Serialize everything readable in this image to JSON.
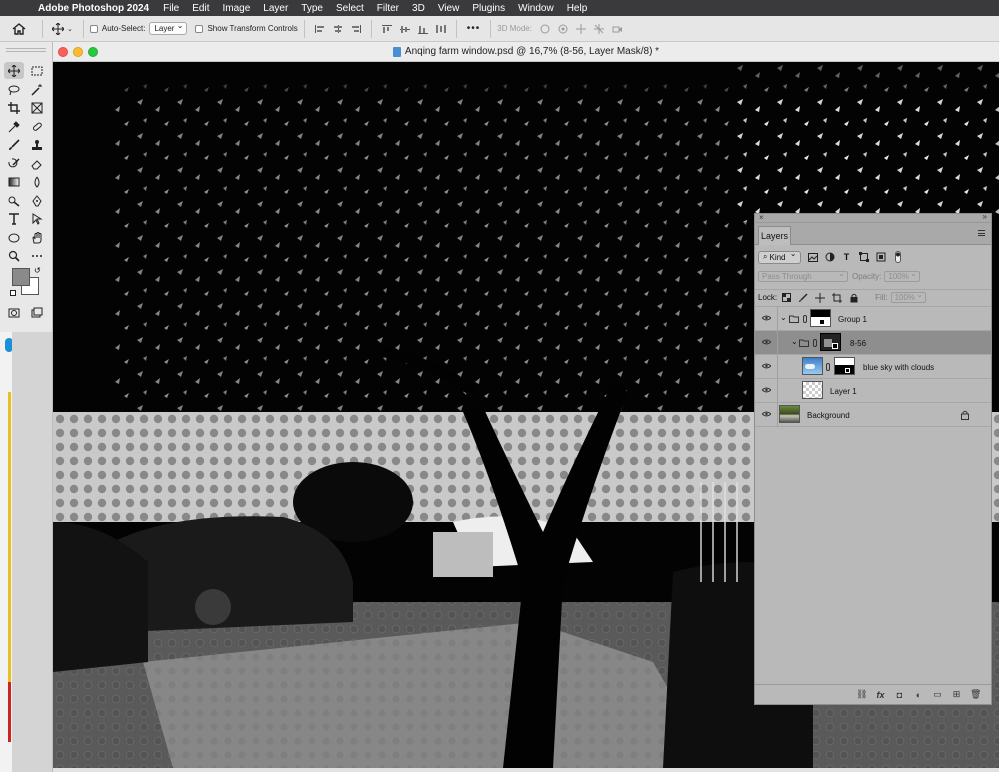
{
  "menubar": {
    "app": "Adobe Photoshop 2024",
    "items": [
      "File",
      "Edit",
      "Image",
      "Layer",
      "Type",
      "Select",
      "Filter",
      "3D",
      "View",
      "Plugins",
      "Window",
      "Help"
    ]
  },
  "options": {
    "auto_select_label": "Auto-Select:",
    "auto_select_value": "Layer",
    "show_transform_label": "Show Transform Controls",
    "mode_3d_label": "3D Mode:"
  },
  "document": {
    "title": "Anqing farm window.psd @ 16,7% (8-56, Layer Mask/8) *"
  },
  "layers_panel": {
    "tab": "Layers",
    "filter_kind": "Kind",
    "blend_mode": "Pass Through",
    "opacity_label": "Opacity:",
    "opacity_value": "100%",
    "lock_label": "Lock:",
    "fill_label": "Fill:",
    "fill_value": "100%",
    "layers": [
      {
        "name": "Group 1",
        "type": "group",
        "expanded": true
      },
      {
        "name": "8-56",
        "type": "group",
        "expanded": true,
        "selected": true
      },
      {
        "name": "blue sky with clouds",
        "type": "image"
      },
      {
        "name": "Layer 1",
        "type": "transparent"
      },
      {
        "name": "Background",
        "type": "image",
        "locked": true
      }
    ]
  },
  "colors": {
    "selected_layer": "#8e8e8e",
    "panel_bg": "#b9b9b9",
    "accent_red": "#fe5f57",
    "accent_yellow": "#febc2e",
    "accent_green": "#28c840"
  }
}
